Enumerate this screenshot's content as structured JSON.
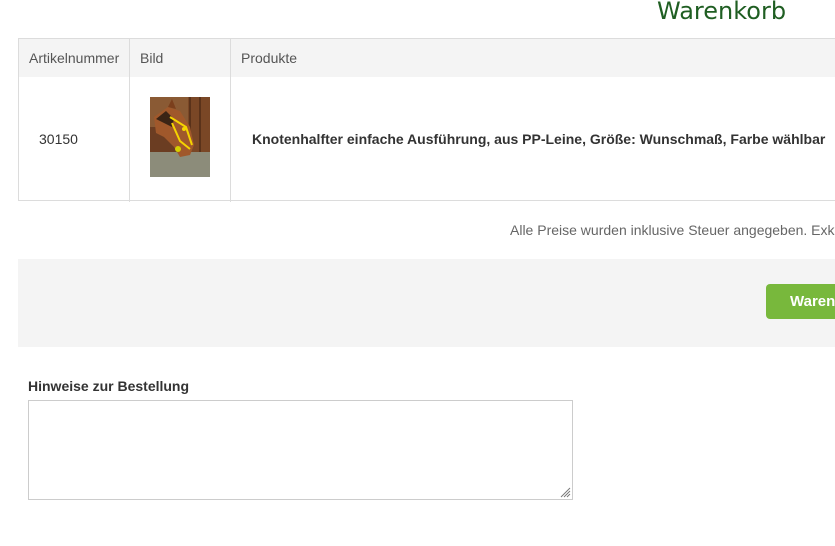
{
  "header": {
    "title": "Warenkorb"
  },
  "cart_table": {
    "columns": [
      "Artikelnummer",
      "Bild",
      "Produkte"
    ],
    "rows": [
      {
        "article_number": "30150",
        "image": "horse-halter-photo",
        "product": "Knotenhalfter einfache Ausführung, aus PP-Leine, Größe: Wunschmaß, Farbe wählbar"
      }
    ]
  },
  "tax_note": "Alle Preise wurden inklusive Steuer angegeben. Exk",
  "actions": {
    "cart_button_label": "Waren"
  },
  "notes": {
    "label": "Hinweise zur Bestellung",
    "value": ""
  },
  "colors": {
    "title": "#1f5e22",
    "button": "#78b83c",
    "panel": "#f4f4f4"
  }
}
